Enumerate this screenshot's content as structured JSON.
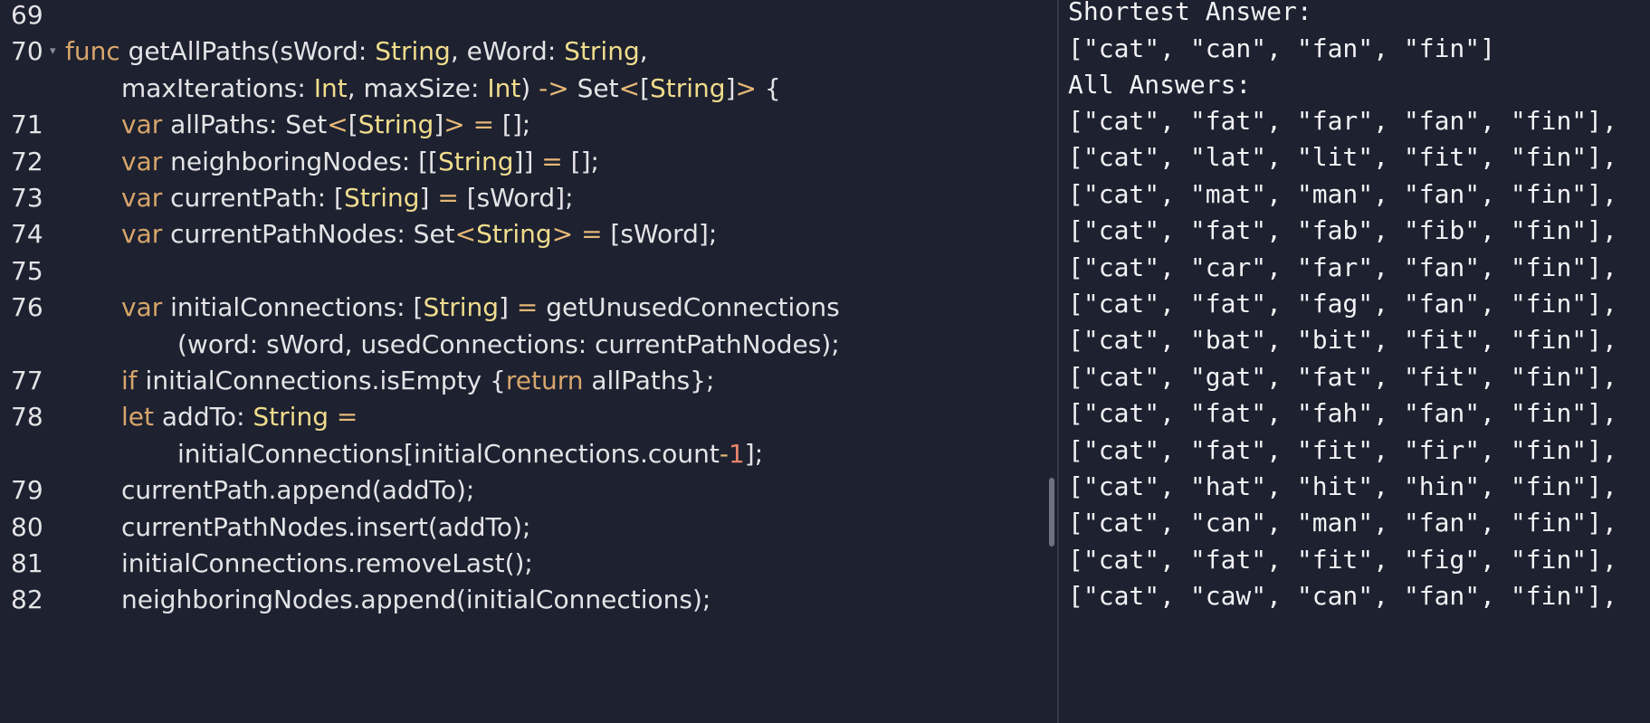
{
  "editor": {
    "lines": [
      {
        "number": "69",
        "tokens": []
      },
      {
        "number": "70",
        "foldable": true,
        "tokens": [
          {
            "t": "func",
            "c": "kw"
          },
          {
            "t": " getAllPaths(sWord: ",
            "c": "pl"
          },
          {
            "t": "String",
            "c": "ty"
          },
          {
            "t": ", eWord: ",
            "c": "pl"
          },
          {
            "t": "String",
            "c": "ty"
          },
          {
            "t": ",",
            "c": "pl"
          }
        ]
      },
      {
        "number": "",
        "indent": 2,
        "tokens": [
          {
            "t": "maxIterations: ",
            "c": "pl"
          },
          {
            "t": "Int",
            "c": "ty"
          },
          {
            "t": ", maxSize: ",
            "c": "pl"
          },
          {
            "t": "Int",
            "c": "ty"
          },
          {
            "t": ") ",
            "c": "pl"
          },
          {
            "t": "->",
            "c": "op"
          },
          {
            "t": " Set",
            "c": "pl"
          },
          {
            "t": "<",
            "c": "op"
          },
          {
            "t": "[",
            "c": "pl"
          },
          {
            "t": "String",
            "c": "ty"
          },
          {
            "t": "]",
            "c": "pl"
          },
          {
            "t": ">",
            "c": "op"
          },
          {
            "t": " {",
            "c": "pl"
          }
        ]
      },
      {
        "number": "71",
        "indent": 2,
        "tokens": [
          {
            "t": "var",
            "c": "kw"
          },
          {
            "t": " allPaths: Set",
            "c": "pl"
          },
          {
            "t": "<",
            "c": "op"
          },
          {
            "t": "[",
            "c": "pl"
          },
          {
            "t": "String",
            "c": "ty"
          },
          {
            "t": "]",
            "c": "pl"
          },
          {
            "t": ">",
            "c": "op"
          },
          {
            "t": " ",
            "c": "pl"
          },
          {
            "t": "=",
            "c": "op"
          },
          {
            "t": " [];",
            "c": "pl"
          }
        ]
      },
      {
        "number": "72",
        "indent": 2,
        "tokens": [
          {
            "t": "var",
            "c": "kw"
          },
          {
            "t": " neighboringNodes: [[",
            "c": "pl"
          },
          {
            "t": "String",
            "c": "ty"
          },
          {
            "t": "]] ",
            "c": "pl"
          },
          {
            "t": "=",
            "c": "op"
          },
          {
            "t": " [];",
            "c": "pl"
          }
        ]
      },
      {
        "number": "73",
        "indent": 2,
        "tokens": [
          {
            "t": "var",
            "c": "kw"
          },
          {
            "t": " currentPath: [",
            "c": "pl"
          },
          {
            "t": "String",
            "c": "ty"
          },
          {
            "t": "] ",
            "c": "pl"
          },
          {
            "t": "=",
            "c": "op"
          },
          {
            "t": " [sWord];",
            "c": "pl"
          }
        ]
      },
      {
        "number": "74",
        "indent": 2,
        "tokens": [
          {
            "t": "var",
            "c": "kw"
          },
          {
            "t": " currentPathNodes: Set",
            "c": "pl"
          },
          {
            "t": "<",
            "c": "op"
          },
          {
            "t": "String",
            "c": "ty"
          },
          {
            "t": ">",
            "c": "op"
          },
          {
            "t": " ",
            "c": "pl"
          },
          {
            "t": "=",
            "c": "op"
          },
          {
            "t": " [sWord];",
            "c": "pl"
          }
        ]
      },
      {
        "number": "75",
        "tokens": []
      },
      {
        "number": "76",
        "indent": 2,
        "tokens": [
          {
            "t": "var",
            "c": "kw"
          },
          {
            "t": " initialConnections: [",
            "c": "pl"
          },
          {
            "t": "String",
            "c": "ty"
          },
          {
            "t": "] ",
            "c": "pl"
          },
          {
            "t": "=",
            "c": "op"
          },
          {
            "t": " getUnusedConnections",
            "c": "pl"
          }
        ]
      },
      {
        "number": "",
        "indent": 4,
        "tokens": [
          {
            "t": "(word: sWord, usedConnections: currentPathNodes);",
            "c": "pl"
          }
        ]
      },
      {
        "number": "77",
        "indent": 2,
        "tokens": [
          {
            "t": "if",
            "c": "kw"
          },
          {
            "t": " initialConnections.isEmpty {",
            "c": "pl"
          },
          {
            "t": "return",
            "c": "kw"
          },
          {
            "t": " allPaths};",
            "c": "pl"
          }
        ]
      },
      {
        "number": "78",
        "indent": 2,
        "tokens": [
          {
            "t": "let",
            "c": "kw"
          },
          {
            "t": " addTo: ",
            "c": "pl"
          },
          {
            "t": "String",
            "c": "ty"
          },
          {
            "t": " ",
            "c": "pl"
          },
          {
            "t": "=",
            "c": "op"
          }
        ]
      },
      {
        "number": "",
        "indent": 4,
        "tokens": [
          {
            "t": "initialConnections[initialConnections.count",
            "c": "pl"
          },
          {
            "t": "-",
            "c": "op"
          },
          {
            "t": "1",
            "c": "num"
          },
          {
            "t": "];",
            "c": "pl"
          }
        ]
      },
      {
        "number": "79",
        "indent": 2,
        "tokens": [
          {
            "t": "currentPath.append(addTo);",
            "c": "pl"
          }
        ]
      },
      {
        "number": "80",
        "indent": 2,
        "tokens": [
          {
            "t": "currentPathNodes.insert(addTo);",
            "c": "pl"
          }
        ]
      },
      {
        "number": "81",
        "indent": 2,
        "tokens": [
          {
            "t": "initialConnections.removeLast();",
            "c": "pl"
          }
        ]
      },
      {
        "number": "82",
        "indent": 2,
        "tokens": [
          {
            "t": "neighboringNodes.append(initialConnections);",
            "c": "pl"
          }
        ]
      }
    ]
  },
  "console": {
    "shortest_label": "Shortest Answer:",
    "shortest_value": "[\"cat\", \"can\", \"fan\", \"fin\"]",
    "all_label": "All Answers:",
    "answers": [
      "[\"cat\", \"fat\", \"far\", \"fan\", \"fin\"],",
      "[\"cat\", \"lat\", \"lit\", \"fit\", \"fin\"],",
      "[\"cat\", \"mat\", \"man\", \"fan\", \"fin\"],",
      "[\"cat\", \"fat\", \"fab\", \"fib\", \"fin\"],",
      "[\"cat\", \"car\", \"far\", \"fan\", \"fin\"],",
      "[\"cat\", \"fat\", \"fag\", \"fan\", \"fin\"],",
      "[\"cat\", \"bat\", \"bit\", \"fit\", \"fin\"],",
      "[\"cat\", \"gat\", \"fat\", \"fit\", \"fin\"],",
      "[\"cat\", \"fat\", \"fah\", \"fan\", \"fin\"],",
      "[\"cat\", \"fat\", \"fit\", \"fir\", \"fin\"],",
      "[\"cat\", \"hat\", \"hit\", \"hin\", \"fin\"],",
      "[\"cat\", \"can\", \"man\", \"fan\", \"fin\"],",
      "[\"cat\", \"fat\", \"fit\", \"fig\", \"fin\"],",
      "[\"cat\", \"caw\", \"can\", \"fan\", \"fin\"],"
    ]
  },
  "colors": {
    "background": "#1d2130",
    "keyword": "#d7a56b",
    "type": "#f0dc8c",
    "operator": "#e6b877",
    "number": "#e8846b",
    "text": "#e4e4e6"
  },
  "icons": {
    "fold": "fold-arrow-icon"
  }
}
